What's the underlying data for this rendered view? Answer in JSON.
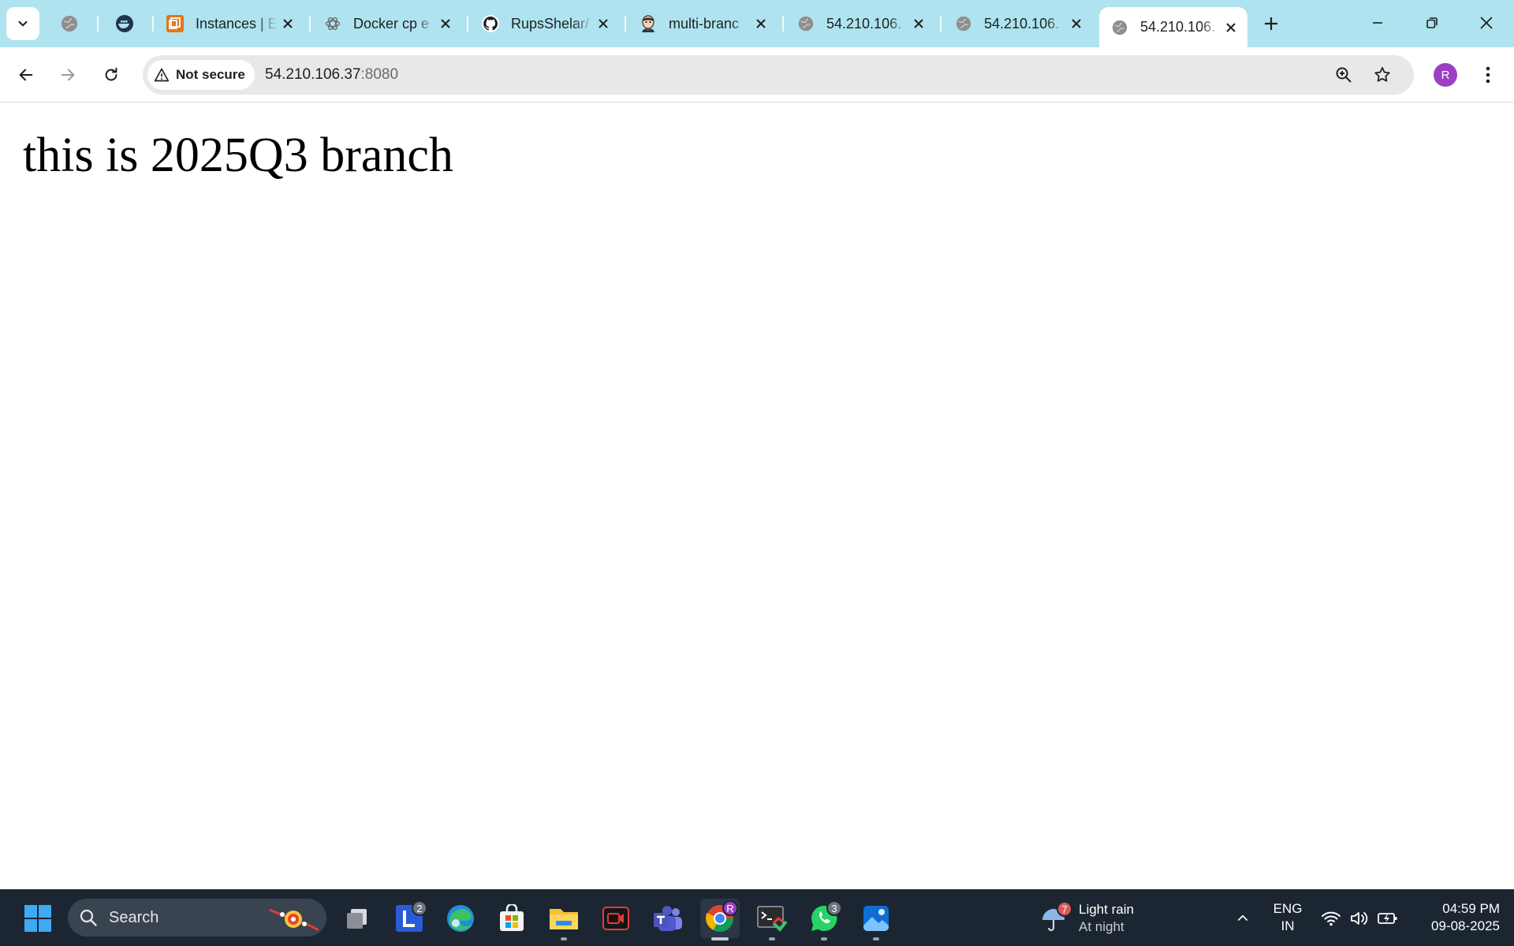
{
  "browser": {
    "tabs": [
      {
        "title": "",
        "favicon": "globe-icon",
        "pinned": true
      },
      {
        "title": "",
        "favicon": "docker-icon",
        "pinned": true
      },
      {
        "title": "Instances | E",
        "favicon": "aws-ec2-icon",
        "close": "✕"
      },
      {
        "title": "Docker cp e",
        "favicon": "chatgpt-icon",
        "close": "✕"
      },
      {
        "title": "RupsShelar/",
        "favicon": "github-icon",
        "close": "✕"
      },
      {
        "title": "multi-branc",
        "favicon": "jenkins-icon",
        "close": "✕"
      },
      {
        "title": "54.210.106.",
        "favicon": "globe-icon",
        "close": "✕"
      },
      {
        "title": "54.210.106.",
        "favicon": "globe-icon",
        "close": "✕"
      },
      {
        "title": "54.210.106.",
        "favicon": "globe-icon",
        "close": "✕",
        "active": true
      }
    ],
    "new_tab_glyph": "+",
    "address_bar": {
      "security_label": "Not secure",
      "host": "54.210.106.37",
      "port": ":8080"
    },
    "profile_initial": "R",
    "colors": {
      "tabstrip": "#aee3ef",
      "profile": "#9c3fc4"
    }
  },
  "page": {
    "heading": "this is 2025Q3 branch"
  },
  "taskbar": {
    "search_placeholder": "Search",
    "apps": [
      {
        "name": "task-view-icon"
      },
      {
        "name": "lens-icon",
        "badge": "2"
      },
      {
        "name": "edge-icon"
      },
      {
        "name": "microsoft-store-icon"
      },
      {
        "name": "file-explorer-icon",
        "running": true
      },
      {
        "name": "screen-recorder-icon"
      },
      {
        "name": "teams-icon"
      },
      {
        "name": "chrome-icon",
        "running": true,
        "active": true,
        "badge": "R"
      },
      {
        "name": "terminal-icon",
        "running": true
      },
      {
        "name": "whatsapp-icon",
        "badge": "3",
        "running": true
      },
      {
        "name": "photos-icon",
        "running": true
      }
    ],
    "weather": {
      "badge": "7",
      "line1": "Light rain",
      "line2": "At night"
    },
    "language": {
      "line1": "ENG",
      "line2": "IN"
    },
    "clock": {
      "time": "04:59 PM",
      "date": "09-08-2025"
    }
  }
}
